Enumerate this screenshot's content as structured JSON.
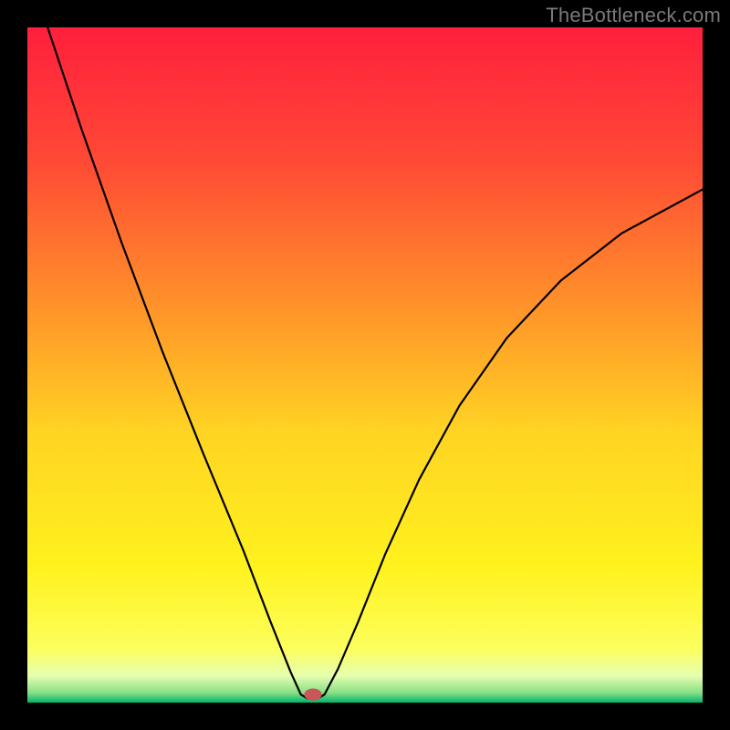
{
  "watermark": "TheBottleneck.com",
  "chart_data": {
    "type": "line",
    "title": "",
    "xlabel": "",
    "ylabel": "",
    "xlim": [
      0,
      100
    ],
    "ylim": [
      0,
      100
    ],
    "grid": false,
    "legend": false,
    "background_gradient_stops": [
      {
        "offset": 0.0,
        "color": "#ff1f3d"
      },
      {
        "offset": 0.2,
        "color": "#ff4a35"
      },
      {
        "offset": 0.4,
        "color": "#ff8e2a"
      },
      {
        "offset": 0.6,
        "color": "#ffd423"
      },
      {
        "offset": 0.8,
        "color": "#fff21e"
      },
      {
        "offset": 0.92,
        "color": "#fcff5d"
      },
      {
        "offset": 0.96,
        "color": "#e6ffb0"
      },
      {
        "offset": 0.985,
        "color": "#8be085"
      },
      {
        "offset": 1.0,
        "color": "#00b36b"
      }
    ],
    "series": [
      {
        "name": "curve",
        "stroke": "#000000",
        "stroke_width": 2.2,
        "points": [
          {
            "x": 3.0,
            "y": 100.0
          },
          {
            "x": 8.0,
            "y": 85.0
          },
          {
            "x": 14.0,
            "y": 68.0
          },
          {
            "x": 20.0,
            "y": 52.0
          },
          {
            "x": 26.0,
            "y": 37.0
          },
          {
            "x": 32.0,
            "y": 22.5
          },
          {
            "x": 36.0,
            "y": 12.0
          },
          {
            "x": 39.0,
            "y": 4.5
          },
          {
            "x": 40.5,
            "y": 1.2
          },
          {
            "x": 41.5,
            "y": 0.6
          },
          {
            "x": 43.0,
            "y": 0.6
          },
          {
            "x": 44.0,
            "y": 1.2
          },
          {
            "x": 46.0,
            "y": 5.0
          },
          {
            "x": 49.0,
            "y": 12.0
          },
          {
            "x": 53.0,
            "y": 22.0
          },
          {
            "x": 58.0,
            "y": 33.0
          },
          {
            "x": 64.0,
            "y": 44.0
          },
          {
            "x": 71.0,
            "y": 54.0
          },
          {
            "x": 79.0,
            "y": 62.5
          },
          {
            "x": 88.0,
            "y": 69.5
          },
          {
            "x": 100.0,
            "y": 76.0
          }
        ]
      }
    ],
    "marker": {
      "name": "minimum-marker",
      "x": 42.3,
      "y": 1.2,
      "rx": 1.3,
      "ry": 0.9,
      "fill": "#c9575a"
    }
  }
}
